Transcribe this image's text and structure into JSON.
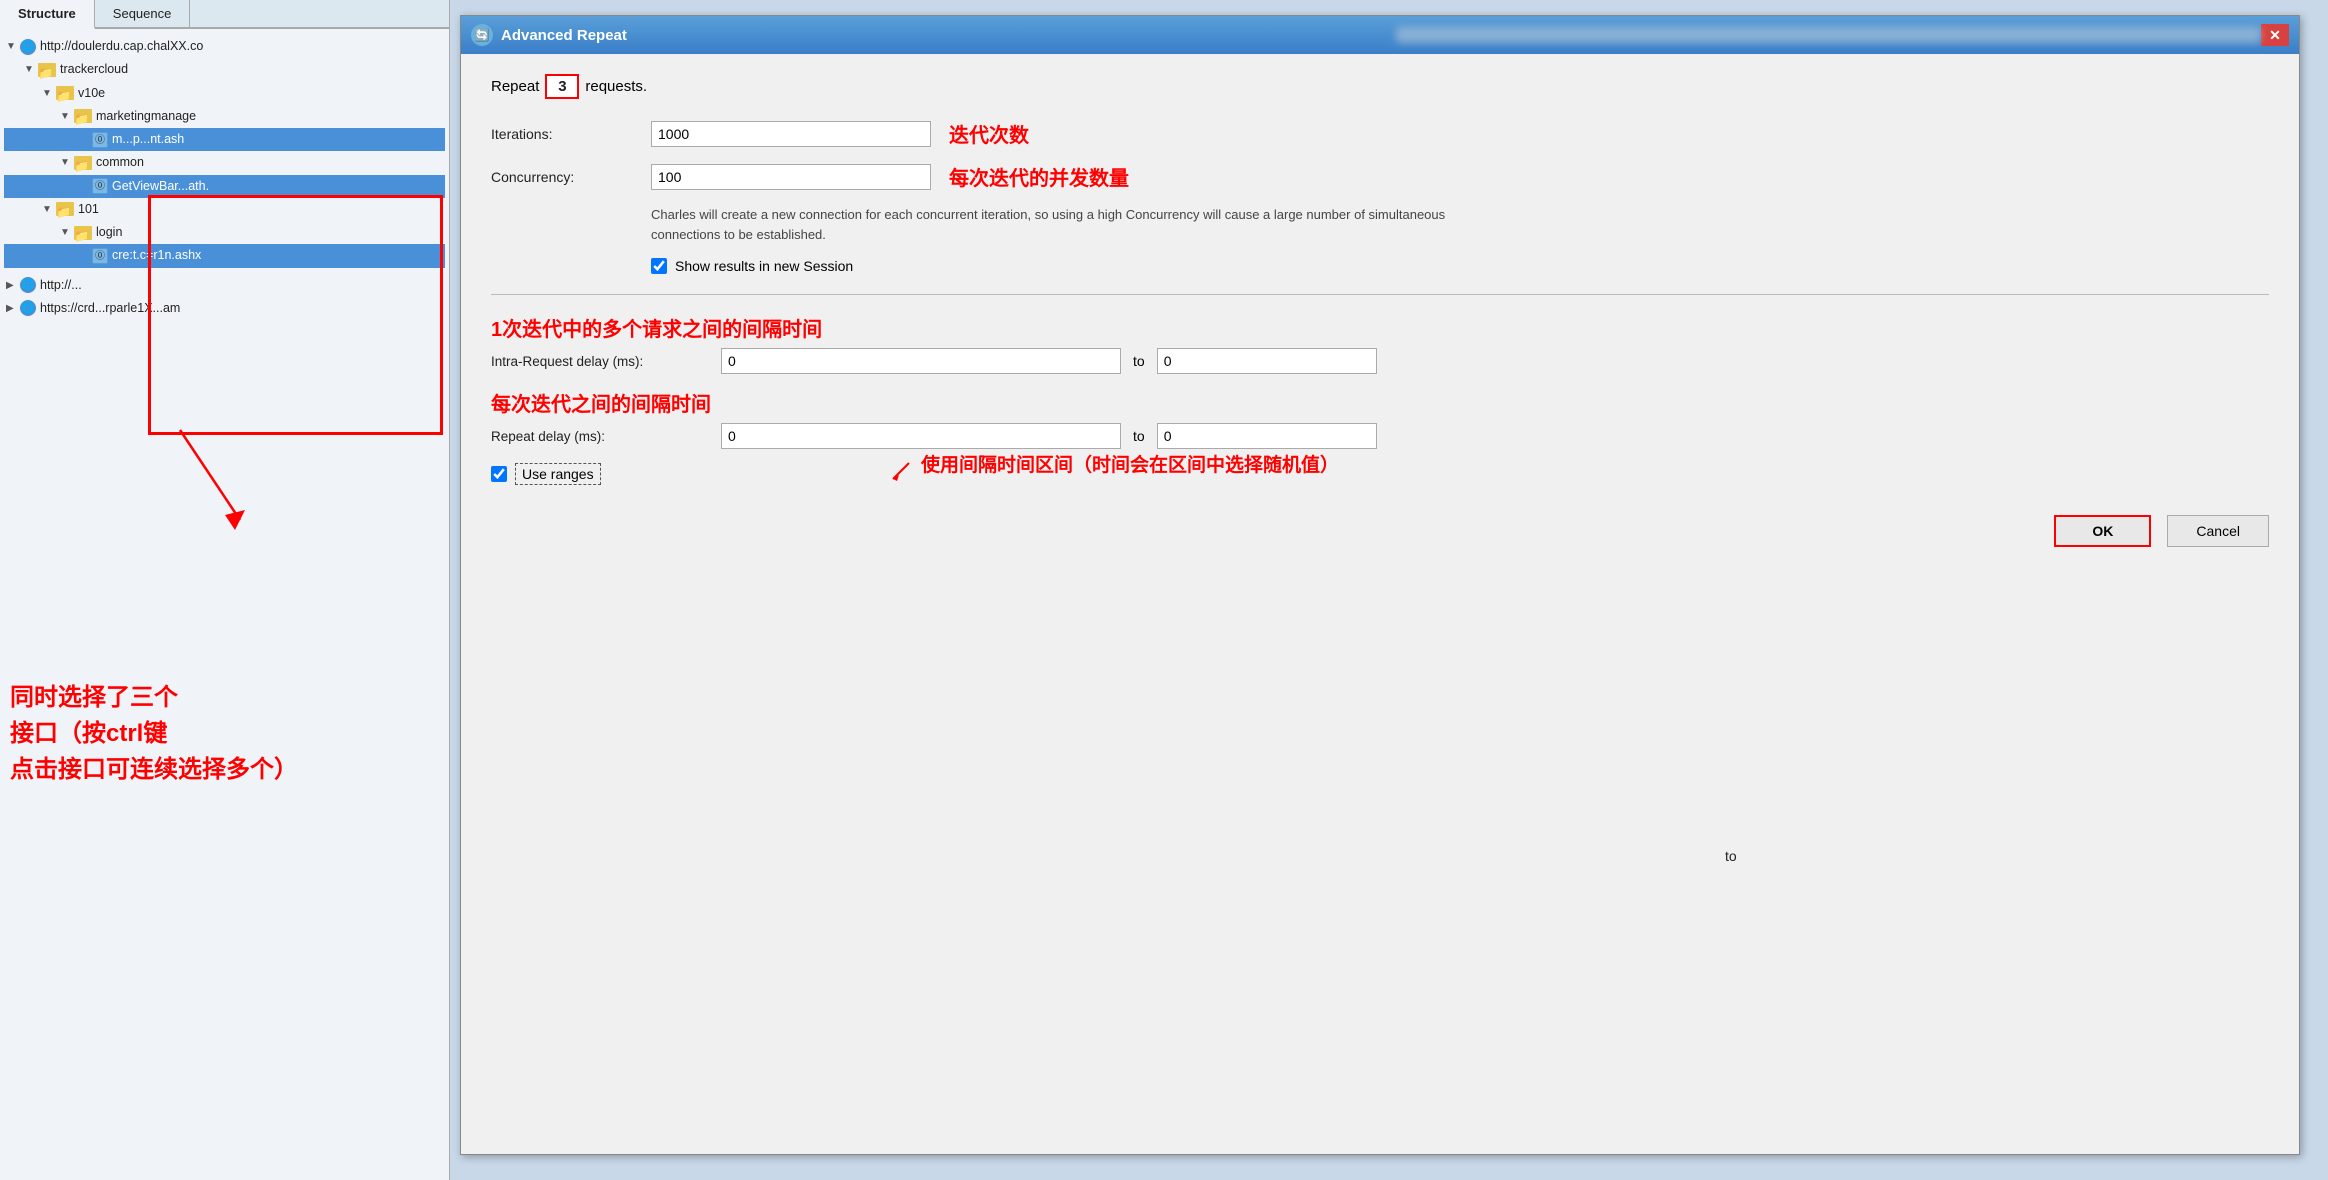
{
  "tabs": {
    "structure_label": "Structure",
    "sequence_label": "Sequence"
  },
  "tree": {
    "root1": {
      "label": "http://doulerdu.cap.chalXX.co",
      "expanded": true
    },
    "folder_trackercloud": {
      "label": "trackercloud",
      "expanded": true
    },
    "folder_v10e": {
      "label": "v10e",
      "expanded": true
    },
    "folder_marketingmanage": {
      "label": "marketingmanage",
      "expanded": true
    },
    "file1": {
      "label": "m...p...nt.ash",
      "selected": true
    },
    "folder_common": {
      "label": "common",
      "expanded": true
    },
    "file2": {
      "label": "GetViewBar...ath.",
      "selected": true
    },
    "folder_101": {
      "label": "101",
      "expanded": true
    },
    "folder_login": {
      "label": "login",
      "expanded": true
    },
    "file3": {
      "label": "cre:t.c=r1n.ashx",
      "selected": true
    },
    "root2": {
      "label": "http://..."
    },
    "root3": {
      "label": "https://crd...rparle1X...am"
    }
  },
  "dialog": {
    "title": "Advanced Repeat",
    "icon": "⚙",
    "close": "✕",
    "repeat_prefix": "Repeat",
    "repeat_number": "3",
    "repeat_suffix": "requests.",
    "iterations_label": "Iterations:",
    "iterations_value": "1000",
    "iterations_annotation": "迭代次数",
    "concurrency_label": "Concurrency:",
    "concurrency_value": "100",
    "concurrency_annotation": "每次迭代的并发数量",
    "description": "Charles will create a new connection for each concurrent iteration, so using a high Concurrency will cause a large number of simultaneous connections to be established.",
    "show_results_label": "Show results in new Session",
    "intra_request_annotation": "1次迭代中的多个请求之间的间隔时间",
    "intra_request_label": "Intra-Request delay (ms):",
    "intra_request_from": "0",
    "intra_request_to": "0",
    "repeat_delay_annotation": "每次迭代之间的间隔时间",
    "repeat_delay_label": "Repeat delay (ms):",
    "repeat_delay_from": "0",
    "repeat_delay_to": "0",
    "use_ranges_label": "Use ranges",
    "use_ranges_annotation": "使用间隔时间区间（时间会在区间中选择随机值）",
    "ok_label": "OK",
    "cancel_label": "Cancel"
  },
  "annotations": {
    "left_bottom": "同时选择了三个\n接口（按ctrl键\n点击接口可连续选择多个）",
    "to_text": "to"
  }
}
